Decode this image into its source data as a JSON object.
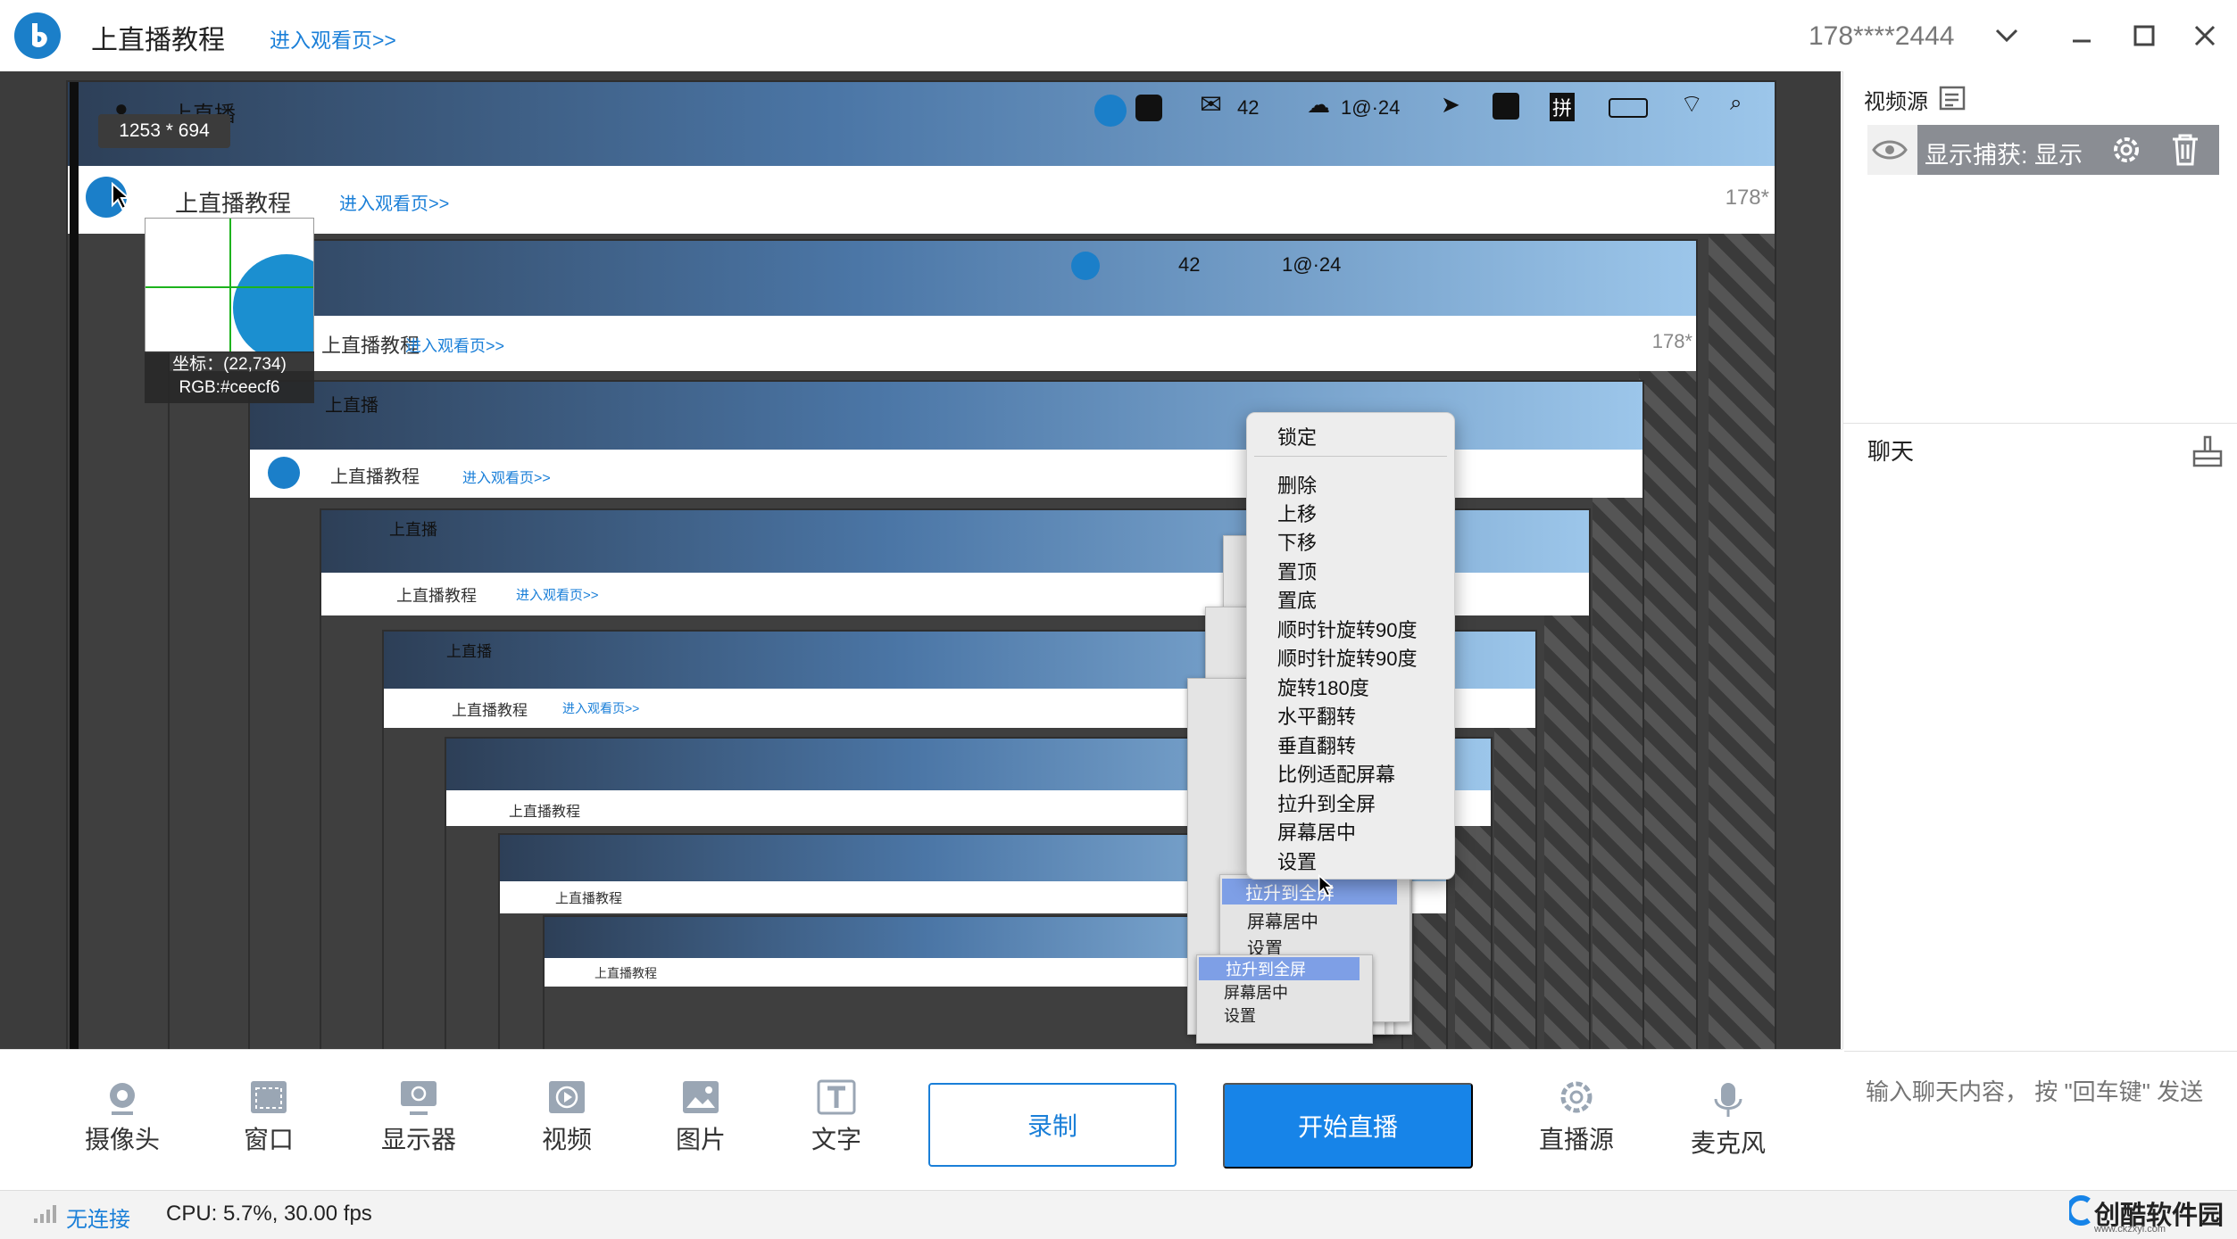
{
  "app": {
    "title": "上直播教程",
    "watch_link": "进入观看页>>",
    "user": "178****2444"
  },
  "preview": {
    "size_badge": "1253 * 694",
    "mac_menubar_title": "上直播",
    "mac_status_count1": "42",
    "mac_status_count2": "1@·24",
    "mac_status_input": "拼",
    "nested_user": "178*",
    "magnifier": {
      "coord": "坐标：(22,734)",
      "rgb": "RGB:#ceecf6"
    }
  },
  "context_menu": {
    "items": [
      "锁定",
      "删除",
      "上移",
      "下移",
      "置顶",
      "置底",
      "顺时针旋转90度",
      "顺时针旋转90度",
      "旋转180度",
      "水平翻转",
      "垂直翻转",
      "比例适配屏幕",
      "拉升到全屏",
      "屏幕居中",
      "设置"
    ]
  },
  "ghost_menus": [
    {
      "items": [
        "拉升到全屏",
        "屏幕居中",
        "设置"
      ]
    },
    {
      "items": [
        "拉升到全屏",
        "屏幕居中",
        "设置"
      ]
    }
  ],
  "right_panel": {
    "source_title": "视频源",
    "source_item": "显示捕获: 显示",
    "chat_title": "聊天",
    "chat_placeholder": "输入聊天内容， 按 \"回车键\" 发送"
  },
  "toolbar": {
    "camera": "摄像头",
    "window": "窗口",
    "display": "显示器",
    "video": "视频",
    "image": "图片",
    "text": "文字",
    "record": "录制",
    "start_live": "开始直播",
    "live_source": "直播源",
    "mic": "麦克风"
  },
  "status": {
    "connection": "无连接",
    "cpu": "CPU: 5.7%,  30.00 fps"
  },
  "watermark": {
    "name": "创酷软件园",
    "url": "www.ckzxyi.com"
  },
  "colors": {
    "accent": "#1784e8",
    "link": "#1a7fd8",
    "menu_bg": "#ededed",
    "selected_row": "#7e9fe6"
  }
}
